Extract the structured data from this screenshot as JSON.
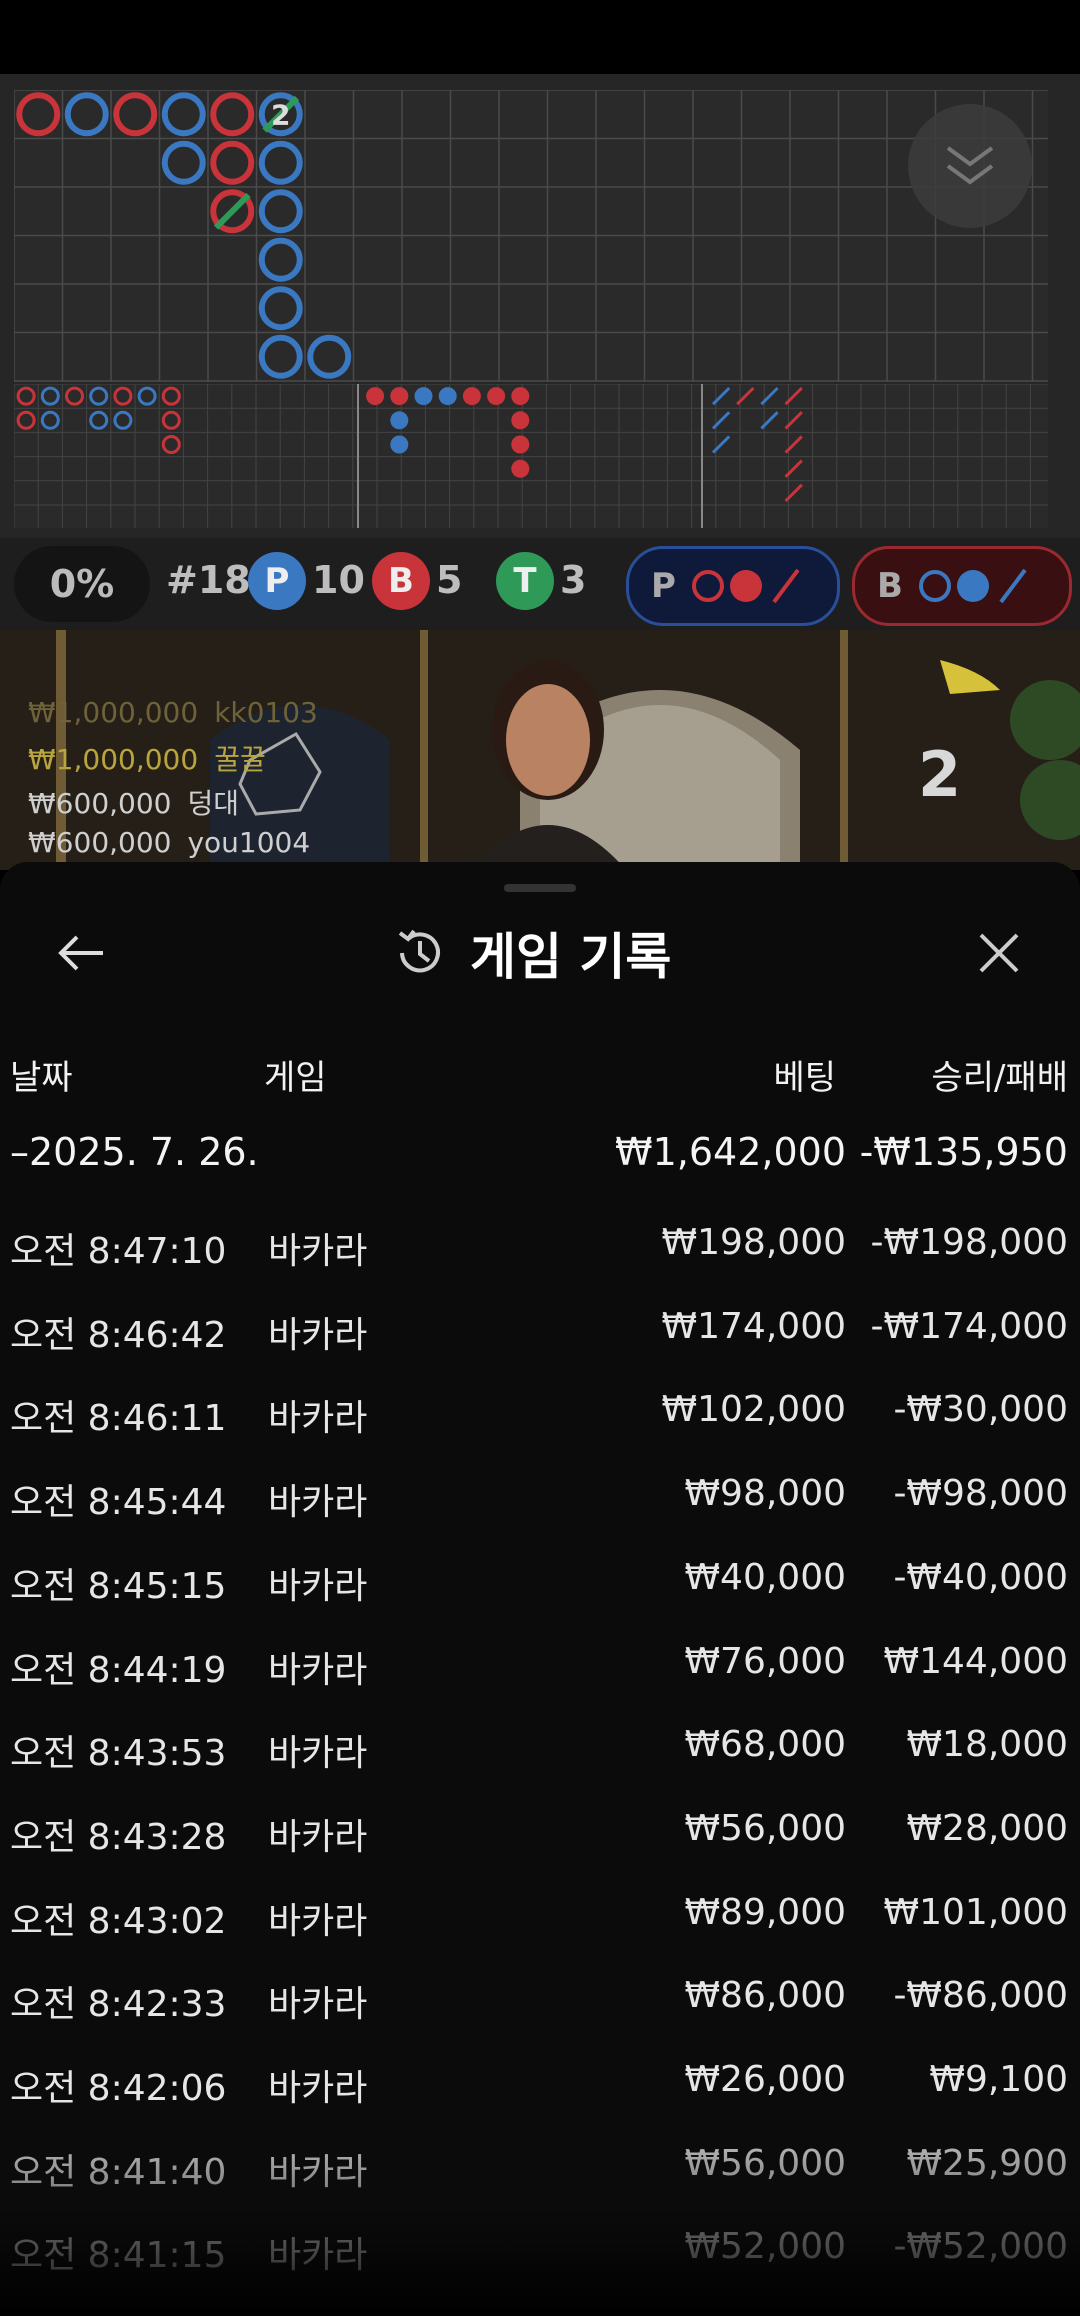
{
  "roadmap": {
    "stats": {
      "percent": "0%",
      "round": "#18",
      "player_letter": "P",
      "player_count": "10",
      "banker_letter": "B",
      "banker_count": "5",
      "tie_letter": "T",
      "tie_count": "3"
    },
    "ask_player_label": "P",
    "ask_banker_label": "B",
    "colors": {
      "player": "#3a78c2",
      "banker": "#c9343a",
      "tie": "#2f9a57"
    },
    "big_road_tie_count": "2"
  },
  "video": {
    "bets": [
      {
        "amount": "₩1,000,000",
        "user": "kk0103"
      },
      {
        "amount": "₩1,000,000",
        "user": "꿀꿀"
      },
      {
        "amount": "₩600,000",
        "user": "덩대"
      },
      {
        "amount": "₩600,000",
        "user": "you1004"
      }
    ],
    "round_number": "2"
  },
  "sheet": {
    "title": "게임 기록",
    "headers": {
      "date": "날짜",
      "game": "게임",
      "bet": "베팅",
      "result": "승리/패배"
    },
    "summary": {
      "date": "–2025. 7. 26.",
      "bet": "₩1,642,000",
      "result": "-₩135,950"
    },
    "rows": [
      {
        "time": "오전 8:47:10",
        "game": "바카라",
        "bet": "₩198,000",
        "result": "-₩198,000"
      },
      {
        "time": "오전 8:46:42",
        "game": "바카라",
        "bet": "₩174,000",
        "result": "-₩174,000"
      },
      {
        "time": "오전 8:46:11",
        "game": "바카라",
        "bet": "₩102,000",
        "result": "-₩30,000"
      },
      {
        "time": "오전 8:45:44",
        "game": "바카라",
        "bet": "₩98,000",
        "result": "-₩98,000"
      },
      {
        "time": "오전 8:45:15",
        "game": "바카라",
        "bet": "₩40,000",
        "result": "-₩40,000"
      },
      {
        "time": "오전 8:44:19",
        "game": "바카라",
        "bet": "₩76,000",
        "result": "₩144,000"
      },
      {
        "time": "오전 8:43:53",
        "game": "바카라",
        "bet": "₩68,000",
        "result": "₩18,000"
      },
      {
        "time": "오전 8:43:28",
        "game": "바카라",
        "bet": "₩56,000",
        "result": "₩28,000"
      },
      {
        "time": "오전 8:43:02",
        "game": "바카라",
        "bet": "₩89,000",
        "result": "₩101,000"
      },
      {
        "time": "오전 8:42:33",
        "game": "바카라",
        "bet": "₩86,000",
        "result": "-₩86,000"
      },
      {
        "time": "오전 8:42:06",
        "game": "바카라",
        "bet": "₩26,000",
        "result": "₩9,100"
      },
      {
        "time": "오전 8:41:40",
        "game": "바카라",
        "bet": "₩56,000",
        "result": "₩25,900"
      },
      {
        "time": "오전 8:41:15",
        "game": "바카라",
        "bet": "₩52,000",
        "result": "-₩52,000"
      }
    ]
  }
}
